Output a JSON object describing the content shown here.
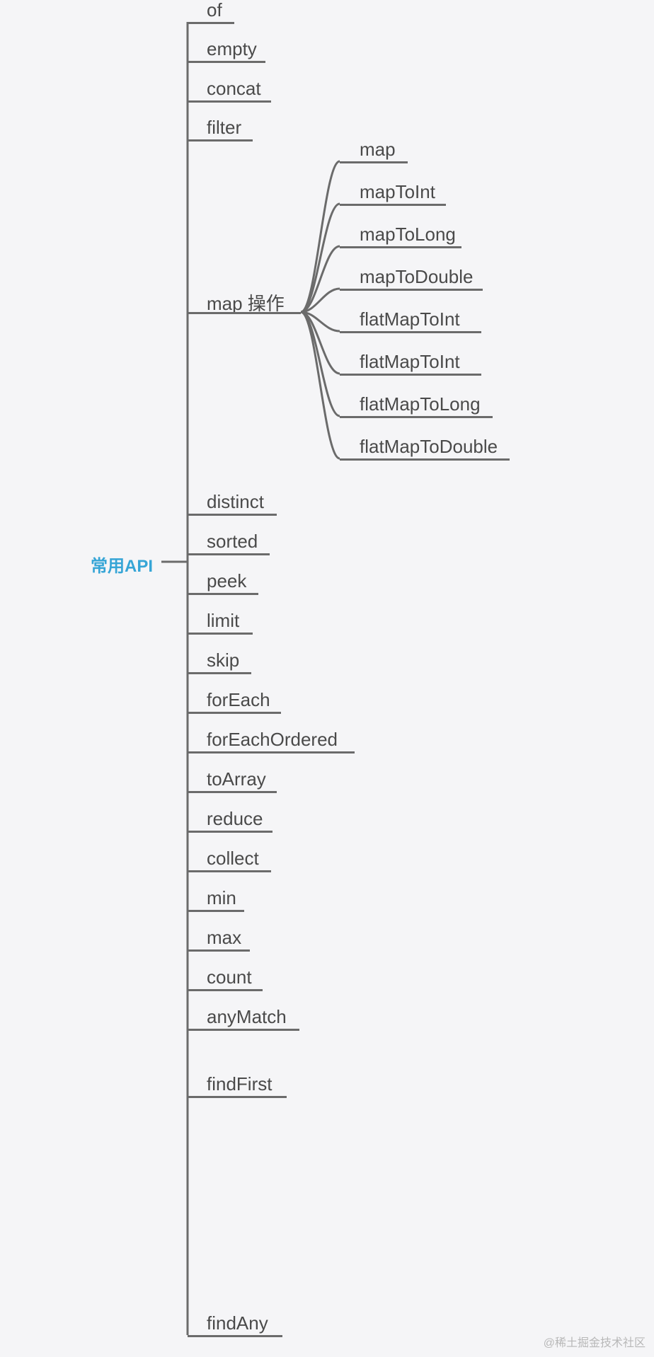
{
  "root": {
    "label": "常用API"
  },
  "level1": [
    {
      "label": "of"
    },
    {
      "label": "empty"
    },
    {
      "label": "concat"
    },
    {
      "label": "filter"
    },
    {
      "label": "map 操作"
    },
    {
      "label": "distinct"
    },
    {
      "label": "sorted"
    },
    {
      "label": "peek"
    },
    {
      "label": "limit"
    },
    {
      "label": "skip"
    },
    {
      "label": "forEach"
    },
    {
      "label": "forEachOrdered"
    },
    {
      "label": "toArray"
    },
    {
      "label": "reduce"
    },
    {
      "label": "collect"
    },
    {
      "label": "min"
    },
    {
      "label": "max"
    },
    {
      "label": "count"
    },
    {
      "label": "anyMatch"
    },
    {
      "label": "findFirst"
    },
    {
      "label": "findAny"
    }
  ],
  "mapChildren": [
    {
      "label": "map"
    },
    {
      "label": "mapToInt"
    },
    {
      "label": "mapToLong"
    },
    {
      "label": "mapToDouble"
    },
    {
      "label": "flatMapToInt"
    },
    {
      "label": "flatMapToInt"
    },
    {
      "label": "flatMapToLong"
    },
    {
      "label": "flatMapToDouble"
    }
  ],
  "watermark": "@稀土掘金技术社区",
  "colors": {
    "bg": "#f5f5f7",
    "line": "#6b6b6b",
    "text": "#4a4a4a",
    "accent": "#36a5d6"
  }
}
